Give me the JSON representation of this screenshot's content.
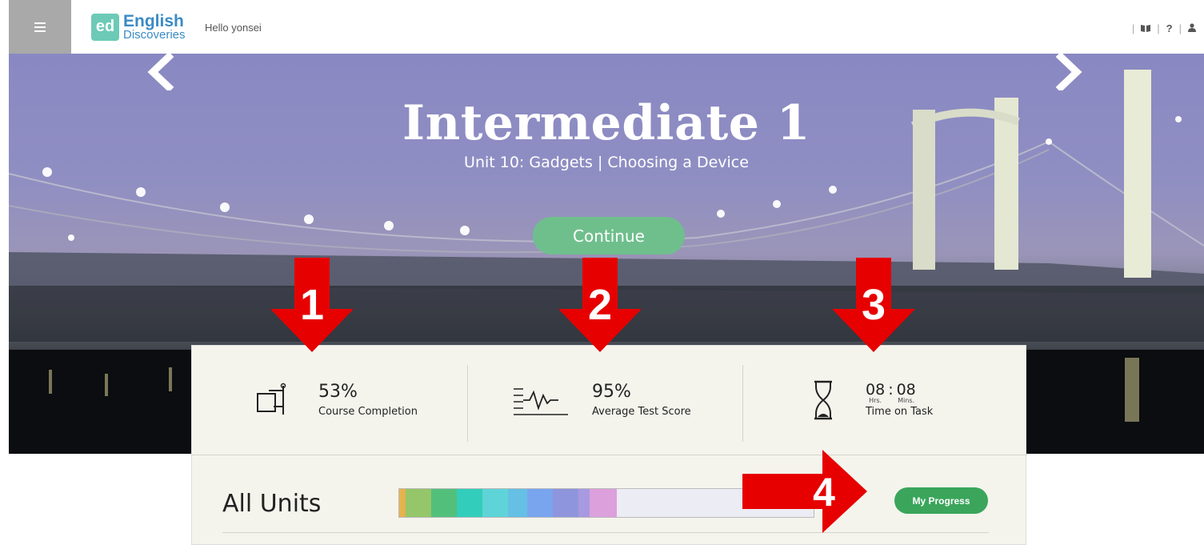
{
  "header": {
    "logo_short": "ed",
    "logo_line1": "English",
    "logo_line2": "Discoveries",
    "greeting": "Hello yonsei",
    "right_icons": [
      "book-icon",
      "help-icon",
      "user-icon"
    ],
    "help_label": "?"
  },
  "hero": {
    "title": "Intermediate 1",
    "unit": "Unit 10: Gadgets",
    "separator": "|",
    "lesson": "Choosing a Device",
    "continue_label": "Continue"
  },
  "stats": {
    "completion": {
      "value": "53%",
      "label": "Course Completion"
    },
    "test_score": {
      "value": "95%",
      "label": "Average Test Score"
    },
    "time": {
      "hours": "08",
      "colon": ":",
      "minutes": "08",
      "hours_label": "Hrs.",
      "minutes_label": "Mins.",
      "label": "Time on Task"
    }
  },
  "units": {
    "title": "All Units",
    "my_progress_label": "My Progress",
    "segment_colors": [
      "#e6b34d",
      "#95c66a",
      "#52c07b",
      "#33cdbb",
      "#5fd4d8",
      "#66bfe4",
      "#79a5ef",
      "#8f95dc",
      "#a79ae0",
      "#dca0dc"
    ]
  },
  "annotations": {
    "n1": "1",
    "n2": "2",
    "n3": "3",
    "n4": "4",
    "color": "#e60000"
  }
}
